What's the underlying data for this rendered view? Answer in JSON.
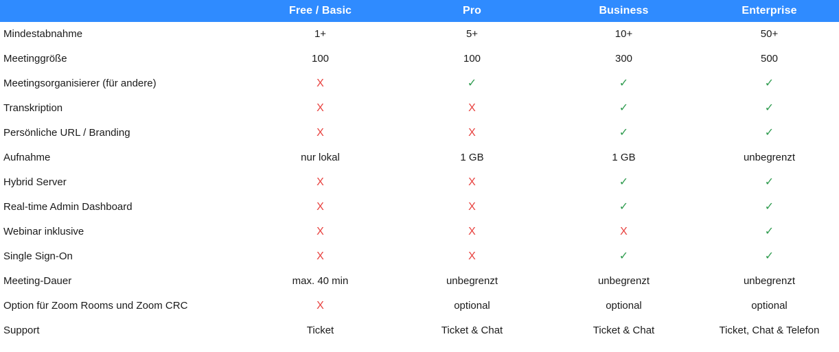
{
  "table": {
    "columns": [
      {
        "key": "feature",
        "label": ""
      },
      {
        "key": "free",
        "label": "Free / Basic"
      },
      {
        "key": "pro",
        "label": "Pro"
      },
      {
        "key": "business",
        "label": "Business"
      },
      {
        "key": "enterprise",
        "label": "Enterprise"
      }
    ],
    "header_bg": "#2f8bff",
    "header_text_color": "#ffffff",
    "yes_color": "#2e9b4e",
    "no_color": "#e8423f",
    "yes_glyph": "✓",
    "no_glyph": "X",
    "rows": [
      {
        "feature": "Mindestabnahme",
        "free": "1+",
        "pro": "5+",
        "business": "10+",
        "enterprise": "50+"
      },
      {
        "feature": "Meetinggröße",
        "free": "100",
        "pro": "100",
        "business": "300",
        "enterprise": "500"
      },
      {
        "feature": "Meetingsorganisierer (für andere)",
        "free": "X",
        "pro": "✓",
        "business": "✓",
        "enterprise": "✓"
      },
      {
        "feature": "Transkription",
        "free": "X",
        "pro": "X",
        "business": "✓",
        "enterprise": "✓"
      },
      {
        "feature": "Persönliche URL / Branding",
        "free": "X",
        "pro": "X",
        "business": "✓",
        "enterprise": "✓"
      },
      {
        "feature": "Aufnahme",
        "free": "nur lokal",
        "pro": "1 GB",
        "business": "1 GB",
        "enterprise": "unbegrenzt"
      },
      {
        "feature": "Hybrid Server",
        "free": "X",
        "pro": "X",
        "business": "✓",
        "enterprise": "✓"
      },
      {
        "feature": "Real-time Admin Dashboard",
        "free": "X",
        "pro": "X",
        "business": "✓",
        "enterprise": "✓"
      },
      {
        "feature": "Webinar inklusive",
        "free": "X",
        "pro": "X",
        "business": "X",
        "enterprise": "✓"
      },
      {
        "feature": "Single Sign-On",
        "free": "X",
        "pro": "X",
        "business": "✓",
        "enterprise": "✓"
      },
      {
        "feature": "Meeting-Dauer",
        "free": "max. 40 min",
        "pro": "unbegrenzt",
        "business": "unbegrenzt",
        "enterprise": "unbegrenzt"
      },
      {
        "feature": "Option für Zoom Rooms und Zoom CRC",
        "free": "X",
        "pro": "optional",
        "business": "optional",
        "enterprise": "optional"
      },
      {
        "feature": "Support",
        "free": "Ticket",
        "pro": "Ticket & Chat",
        "business": "Ticket & Chat",
        "enterprise": "Ticket, Chat & Telefon"
      }
    ]
  }
}
